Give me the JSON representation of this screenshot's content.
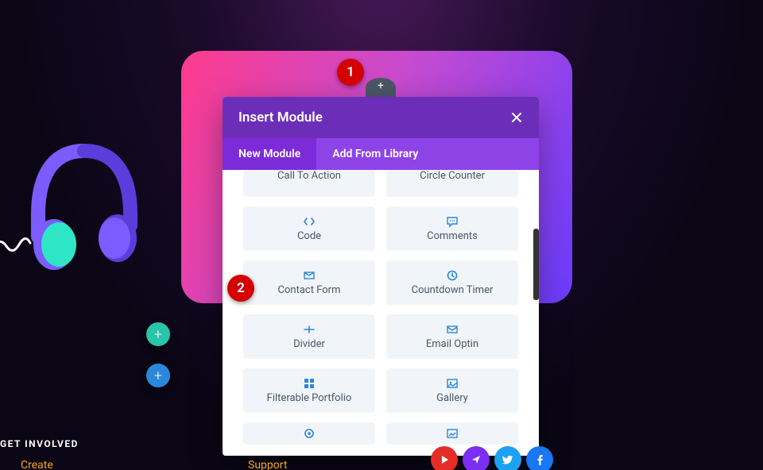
{
  "modal": {
    "title": "Insert Module",
    "tabs": {
      "new": "New Module",
      "library": "Add From Library"
    },
    "modules": [
      {
        "label": "Call To Action",
        "icon": "megaphone"
      },
      {
        "label": "Circle Counter",
        "icon": "circle"
      },
      {
        "label": "Code",
        "icon": "code"
      },
      {
        "label": "Comments",
        "icon": "comment"
      },
      {
        "label": "Contact Form",
        "icon": "mail"
      },
      {
        "label": "Countdown Timer",
        "icon": "clock"
      },
      {
        "label": "Divider",
        "icon": "divider"
      },
      {
        "label": "Email Optin",
        "icon": "envelope"
      },
      {
        "label": "Filterable Portfolio",
        "icon": "grid"
      },
      {
        "label": "Gallery",
        "icon": "image"
      },
      {
        "label": "",
        "icon": "target"
      },
      {
        "label": "",
        "icon": "picture"
      }
    ]
  },
  "annotations": {
    "one": "1",
    "two": "2"
  },
  "footer": {
    "heading": "GET INVOLVED",
    "create": "Create",
    "support": "Support"
  },
  "icons": {
    "plus": "+"
  }
}
